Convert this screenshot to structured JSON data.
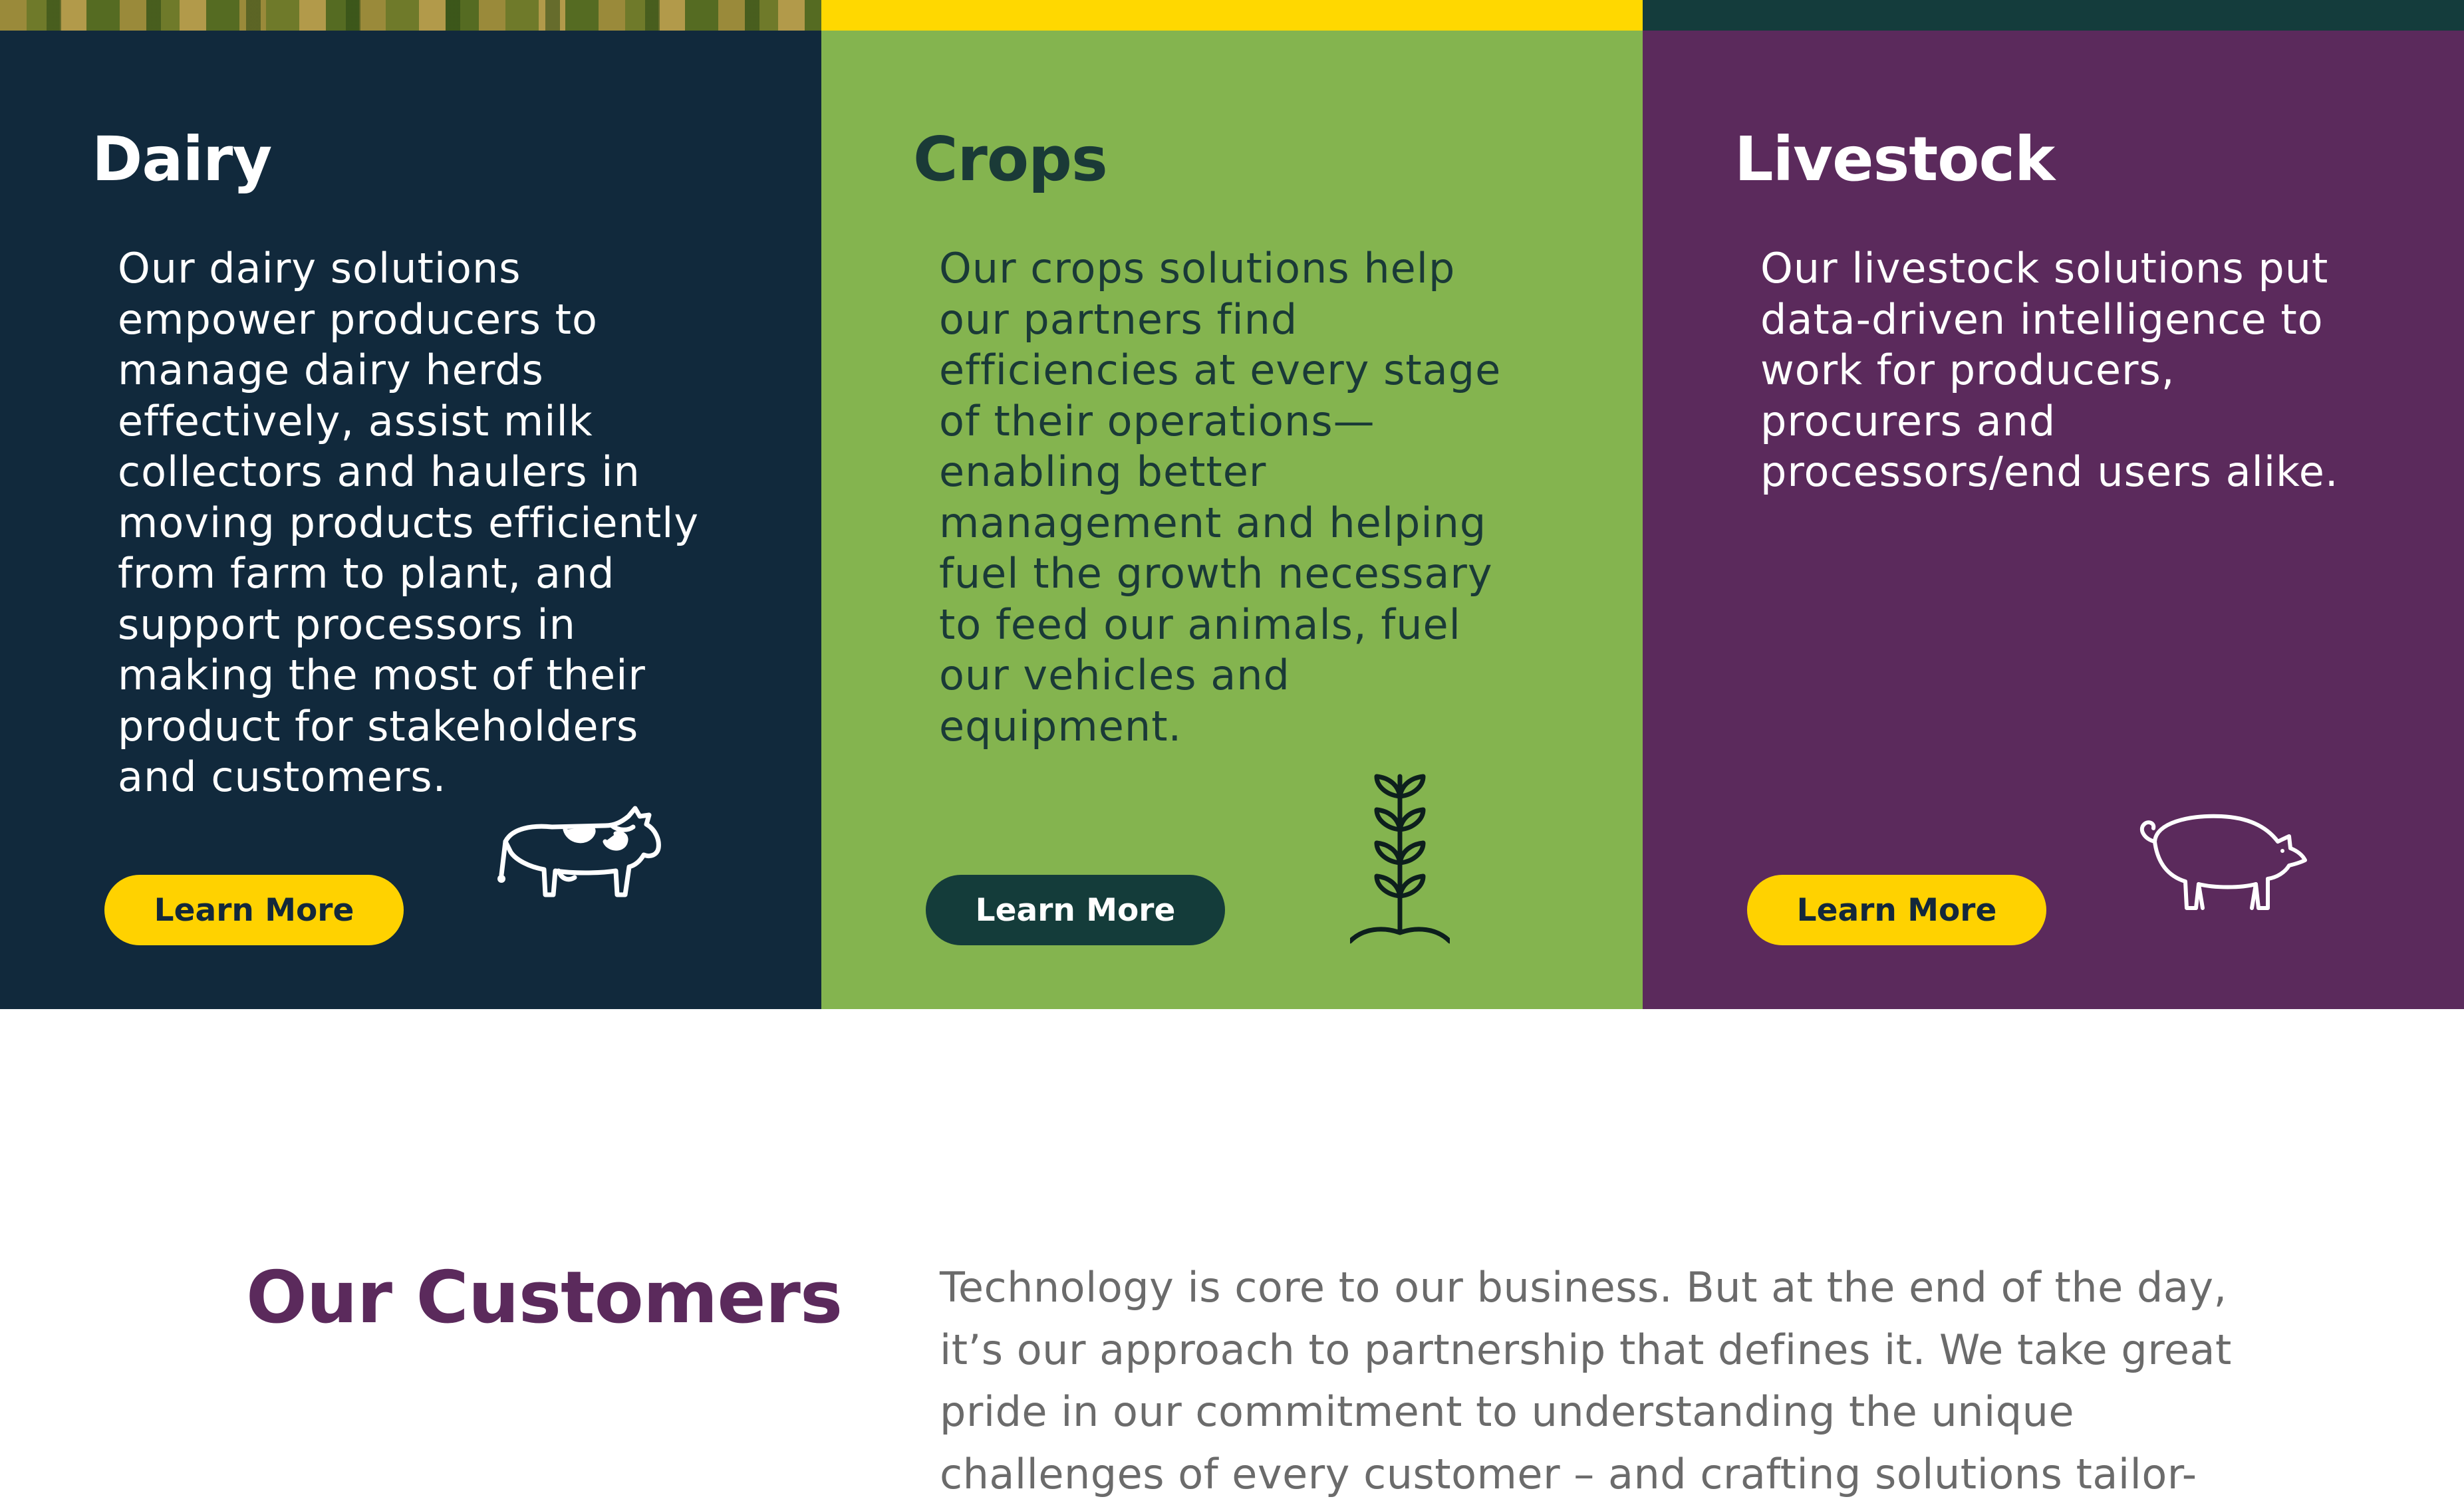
{
  "cards": [
    {
      "title": "Dairy",
      "body": "Our dairy solutions empower producers to manage dairy herds effectively, assist milk collectors and haulers in moving products efficiently from farm to plant, and support processors in making the most of their product for stakeholders and customers.",
      "button_label": "Learn More",
      "icon": "cow-icon",
      "bg_color": "#11293c"
    },
    {
      "title": "Crops",
      "body": "Our crops solutions help our partners find efficiencies at every stage of their operations—enabling better management and helping fuel the growth necessary to feed our animals, fuel our vehicles and equipment.",
      "button_label": "Learn More",
      "icon": "plant-icon",
      "bg_color": "#84b44f"
    },
    {
      "title": "Livestock",
      "body": "Our livestock solutions put data-driven intelligence to work for producers, procurers and processors/end users alike.",
      "button_label": "Learn More",
      "icon": "pig-icon",
      "bg_color": "#5b2a5c"
    }
  ],
  "customers": {
    "title": "Our Customers",
    "text": "Technology is core to our business. But at the end of the day, it’s our approach to partnership that defines it. We take great pride in our commitment to understanding the unique challenges of every customer – and crafting solutions tailor-"
  },
  "colors": {
    "accent_yellow": "#ffd200",
    "dark_green": "#143c3a",
    "purple": "#5b2a5c"
  }
}
